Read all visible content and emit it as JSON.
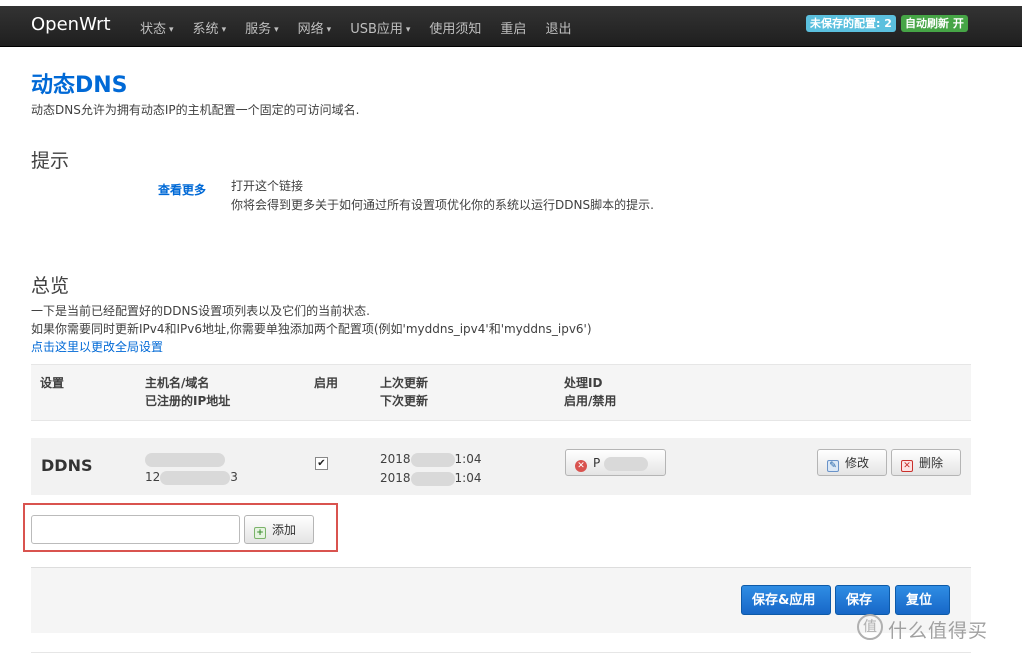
{
  "navbar": {
    "brand": "OpenWrt",
    "menu": [
      {
        "label": "状态",
        "caret": "▾"
      },
      {
        "label": "系统",
        "caret": "▾"
      },
      {
        "label": "服务",
        "caret": "▾"
      },
      {
        "label": "网络",
        "caret": "▾"
      },
      {
        "label": "USB应用",
        "caret": "▾"
      },
      {
        "label": "使用须知",
        "caret": ""
      },
      {
        "label": "重启",
        "caret": ""
      },
      {
        "label": "退出",
        "caret": ""
      }
    ],
    "unsaved_badge": "未保存的配置: 2",
    "autorefresh_badge": "自动刷新 开"
  },
  "page": {
    "title": "动态DNS",
    "description": "动态DNS允许为拥有动态IP的主机配置一个固定的可访问域名."
  },
  "hints": {
    "title": "提示",
    "link": "查看更多",
    "line1": "打开这个链接",
    "line2": "你将会得到更多关于如何通过所有设置项优化你的系统以运行DDNS脚本的提示."
  },
  "overview": {
    "title": "总览",
    "line1": "一下是当前已经配置好的DDNS设置项列表以及它们的当前状态.",
    "line2": "如果你需要同时更新IPv4和IPv6地址,你需要单独添加两个配置项(例如'myddns_ipv4'和'myddns_ipv6')",
    "global_link": "点击这里以更改全局设置"
  },
  "table": {
    "headers": {
      "setting": "设置",
      "host_line1": "主机名/域名",
      "host_line2": "已注册的IP地址",
      "enabled": "启用",
      "update_line1": "上次更新",
      "update_line2": "下次更新",
      "pid_line1": "处理ID",
      "pid_line2": "启用/禁用"
    },
    "rows": [
      {
        "name": "DDNS",
        "ip_prefix": "12",
        "ip_suffix": "3",
        "enabled": "✔",
        "last_update_prefix": "2018",
        "last_update_suffix": "1:04",
        "next_update_prefix": "2018",
        "next_update_suffix": "1:04",
        "process_button": "P",
        "edit_button": "修改",
        "delete_button": "删除"
      }
    ]
  },
  "add": {
    "input_value": "",
    "button": "添加"
  },
  "footer": {
    "save_apply": "保存&应用",
    "save": "保存",
    "reset": "复位"
  },
  "watermark": {
    "symbol": "值",
    "text": "什么值得买"
  },
  "colors": {
    "navbar_bg": "#222222",
    "link": "#0069d6",
    "badge_unsaved": "#5bc0de",
    "badge_refresh": "#46a546",
    "primary_button": "#1d72d0",
    "highlight_box": "#d9534f"
  }
}
